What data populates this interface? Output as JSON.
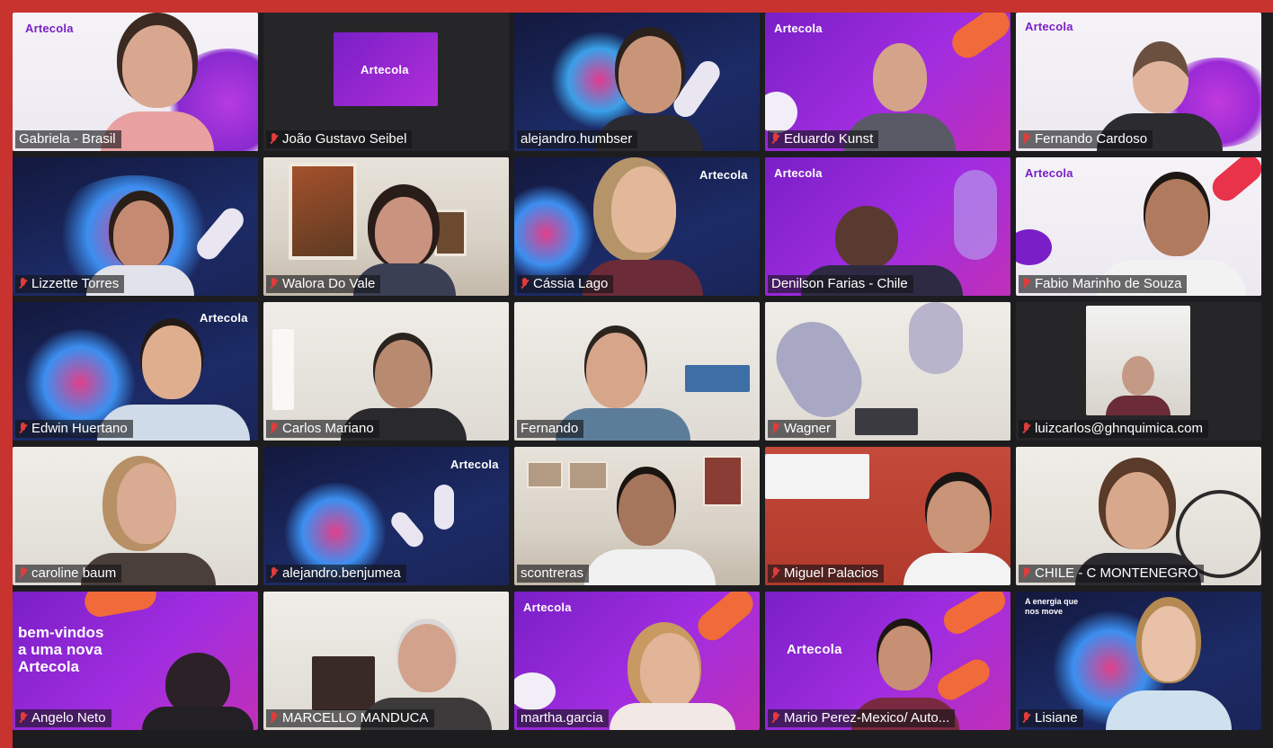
{
  "participants": [
    {
      "name": "Gabriela - Brasil",
      "muted": false,
      "speaking": true,
      "bg": "bg-white",
      "brand": "Artecola",
      "brand_style": "dark"
    },
    {
      "name": "João Gustavo Seibel",
      "muted": true,
      "bg": "bg-dark",
      "brand": "Artecola",
      "brand_style": "logo-card"
    },
    {
      "name": "alejandro.humbser",
      "muted": false,
      "bg": "bg-navy"
    },
    {
      "name": "Eduardo Kunst",
      "muted": true,
      "bg": "bg-purple",
      "brand": "Artecola"
    },
    {
      "name": "Fernando Cardoso",
      "muted": true,
      "bg": "bg-white",
      "brand": "Artecola",
      "brand_style": "dark"
    },
    {
      "name": "Lizzette Torres",
      "muted": true,
      "bg": "bg-navy"
    },
    {
      "name": "Walora Do Vale",
      "muted": true,
      "bg": "bg-room"
    },
    {
      "name": "Cássia Lago",
      "muted": true,
      "bg": "bg-navy",
      "brand": "Artecola"
    },
    {
      "name": "Denilson Farias - Chile",
      "muted": false,
      "bg": "bg-purple",
      "brand": "Artecola"
    },
    {
      "name": "Fabio Marinho de Souza",
      "muted": true,
      "bg": "bg-white",
      "brand": "Artecola",
      "brand_style": "dark"
    },
    {
      "name": "Edwin Huertano",
      "muted": true,
      "bg": "bg-navy",
      "brand": "Artecola"
    },
    {
      "name": "Carlos Mariano",
      "muted": true,
      "bg": "bg-room2"
    },
    {
      "name": "Fernando",
      "muted": false,
      "bg": "bg-room2"
    },
    {
      "name": "Wagner",
      "muted": true,
      "bg": "bg-room2"
    },
    {
      "name": "luizcarlos@ghnquimica.com",
      "muted": true,
      "bg": "bg-dark"
    },
    {
      "name": "caroline baum",
      "muted": true,
      "bg": "bg-room2"
    },
    {
      "name": "alejandro.benjumea",
      "muted": true,
      "bg": "bg-navy",
      "brand": "Artecola"
    },
    {
      "name": "scontreras",
      "muted": false,
      "bg": "bg-room"
    },
    {
      "name": "Miguel Palacios",
      "muted": true,
      "bg": "bg-red"
    },
    {
      "name": "CHILE - C MONTENEGRO",
      "muted": true,
      "bg": "bg-room2"
    },
    {
      "name": "Angelo Neto",
      "muted": true,
      "bg": "bg-purple",
      "overlay": [
        "bem-vindos",
        "a uma nova",
        "Artecola"
      ]
    },
    {
      "name": "MARCELLO MANDUCA",
      "muted": true,
      "bg": "bg-room2"
    },
    {
      "name": "martha.garcia",
      "muted": false,
      "bg": "bg-purple",
      "brand": "Artecola"
    },
    {
      "name": "Mario Perez-Mexico/ Auto...",
      "muted": true,
      "bg": "bg-purple",
      "brand": "Artecola"
    },
    {
      "name": "Lisiane",
      "muted": true,
      "bg": "bg-navy",
      "overlay": [
        "A energia que",
        "nos move"
      ]
    }
  ]
}
